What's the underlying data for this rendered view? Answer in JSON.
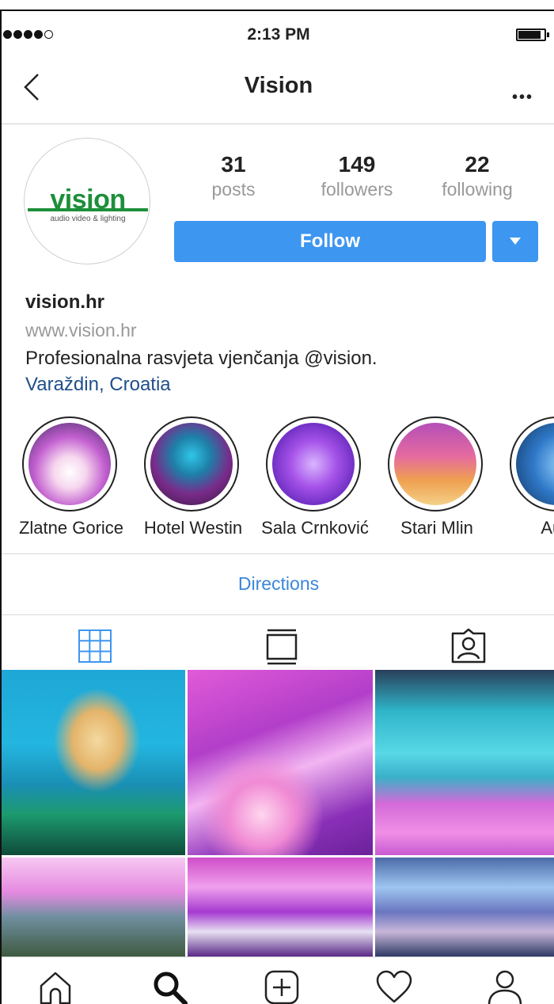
{
  "status_bar": {
    "time": "2:13 PM",
    "signal_dots_filled": 4,
    "signal_dots_total": 5,
    "battery_level": 0.8
  },
  "nav": {
    "title": "Vision",
    "back_icon": "chevron-left-icon",
    "more_label": "•••"
  },
  "profile": {
    "logo_text": "vision",
    "logo_tagline": "audio video & lighting",
    "stats": [
      {
        "value": "31",
        "label": "posts"
      },
      {
        "value": "149",
        "label": "followers"
      },
      {
        "value": "22",
        "label": "following"
      }
    ],
    "follow_label": "Follow",
    "username": "vision.hr",
    "website": "www.vision.hr",
    "bio": "Profesionalna rasvjeta vjenčanja @vision.",
    "location": "Varaždin, Croatia"
  },
  "highlights": [
    {
      "label": "Zlatne Gorice"
    },
    {
      "label": "Hotel Westin"
    },
    {
      "label": "Sala Crnković"
    },
    {
      "label": "Stari Mlin"
    },
    {
      "label": "Auto"
    }
  ],
  "directions_label": "Directions",
  "tabs": [
    {
      "icon": "grid-icon",
      "active": true
    },
    {
      "icon": "list-icon",
      "active": false
    },
    {
      "icon": "tagged-icon",
      "active": false
    }
  ],
  "bottom_nav": [
    {
      "icon": "home-icon"
    },
    {
      "icon": "search-icon"
    },
    {
      "icon": "add-icon"
    },
    {
      "icon": "heart-icon"
    },
    {
      "icon": "profile-icon"
    }
  ],
  "colors": {
    "accent": "#3d96f0",
    "location_link": "#1f4f8a",
    "directions_link": "#3a87d8",
    "logo_green": "#1d8f3a"
  }
}
